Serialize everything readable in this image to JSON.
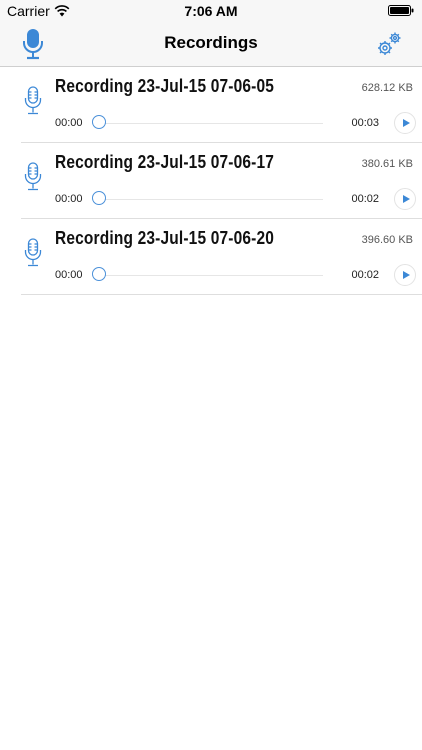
{
  "status_bar": {
    "carrier": "Carrier",
    "time": "7:06 AM",
    "wifi_icon": "wifi-icon",
    "battery_icon": "battery-icon"
  },
  "nav": {
    "title": "Recordings",
    "left_icon": "microphone-icon",
    "right_icon": "gear-icon"
  },
  "colors": {
    "accent": "#3c88d6",
    "bar_background": "#f7f7f7",
    "separator": "#dedede"
  },
  "recordings": [
    {
      "title": "Recording 23-Jul-15 07-06-05",
      "size": "628.12 KB",
      "current_time": "00:00",
      "duration": "00:03",
      "progress": 0
    },
    {
      "title": "Recording 23-Jul-15 07-06-17",
      "size": "380.61 KB",
      "current_time": "00:00",
      "duration": "00:02",
      "progress": 0
    },
    {
      "title": "Recording 23-Jul-15 07-06-20",
      "size": "396.60 KB",
      "current_time": "00:00",
      "duration": "00:02",
      "progress": 0
    }
  ]
}
